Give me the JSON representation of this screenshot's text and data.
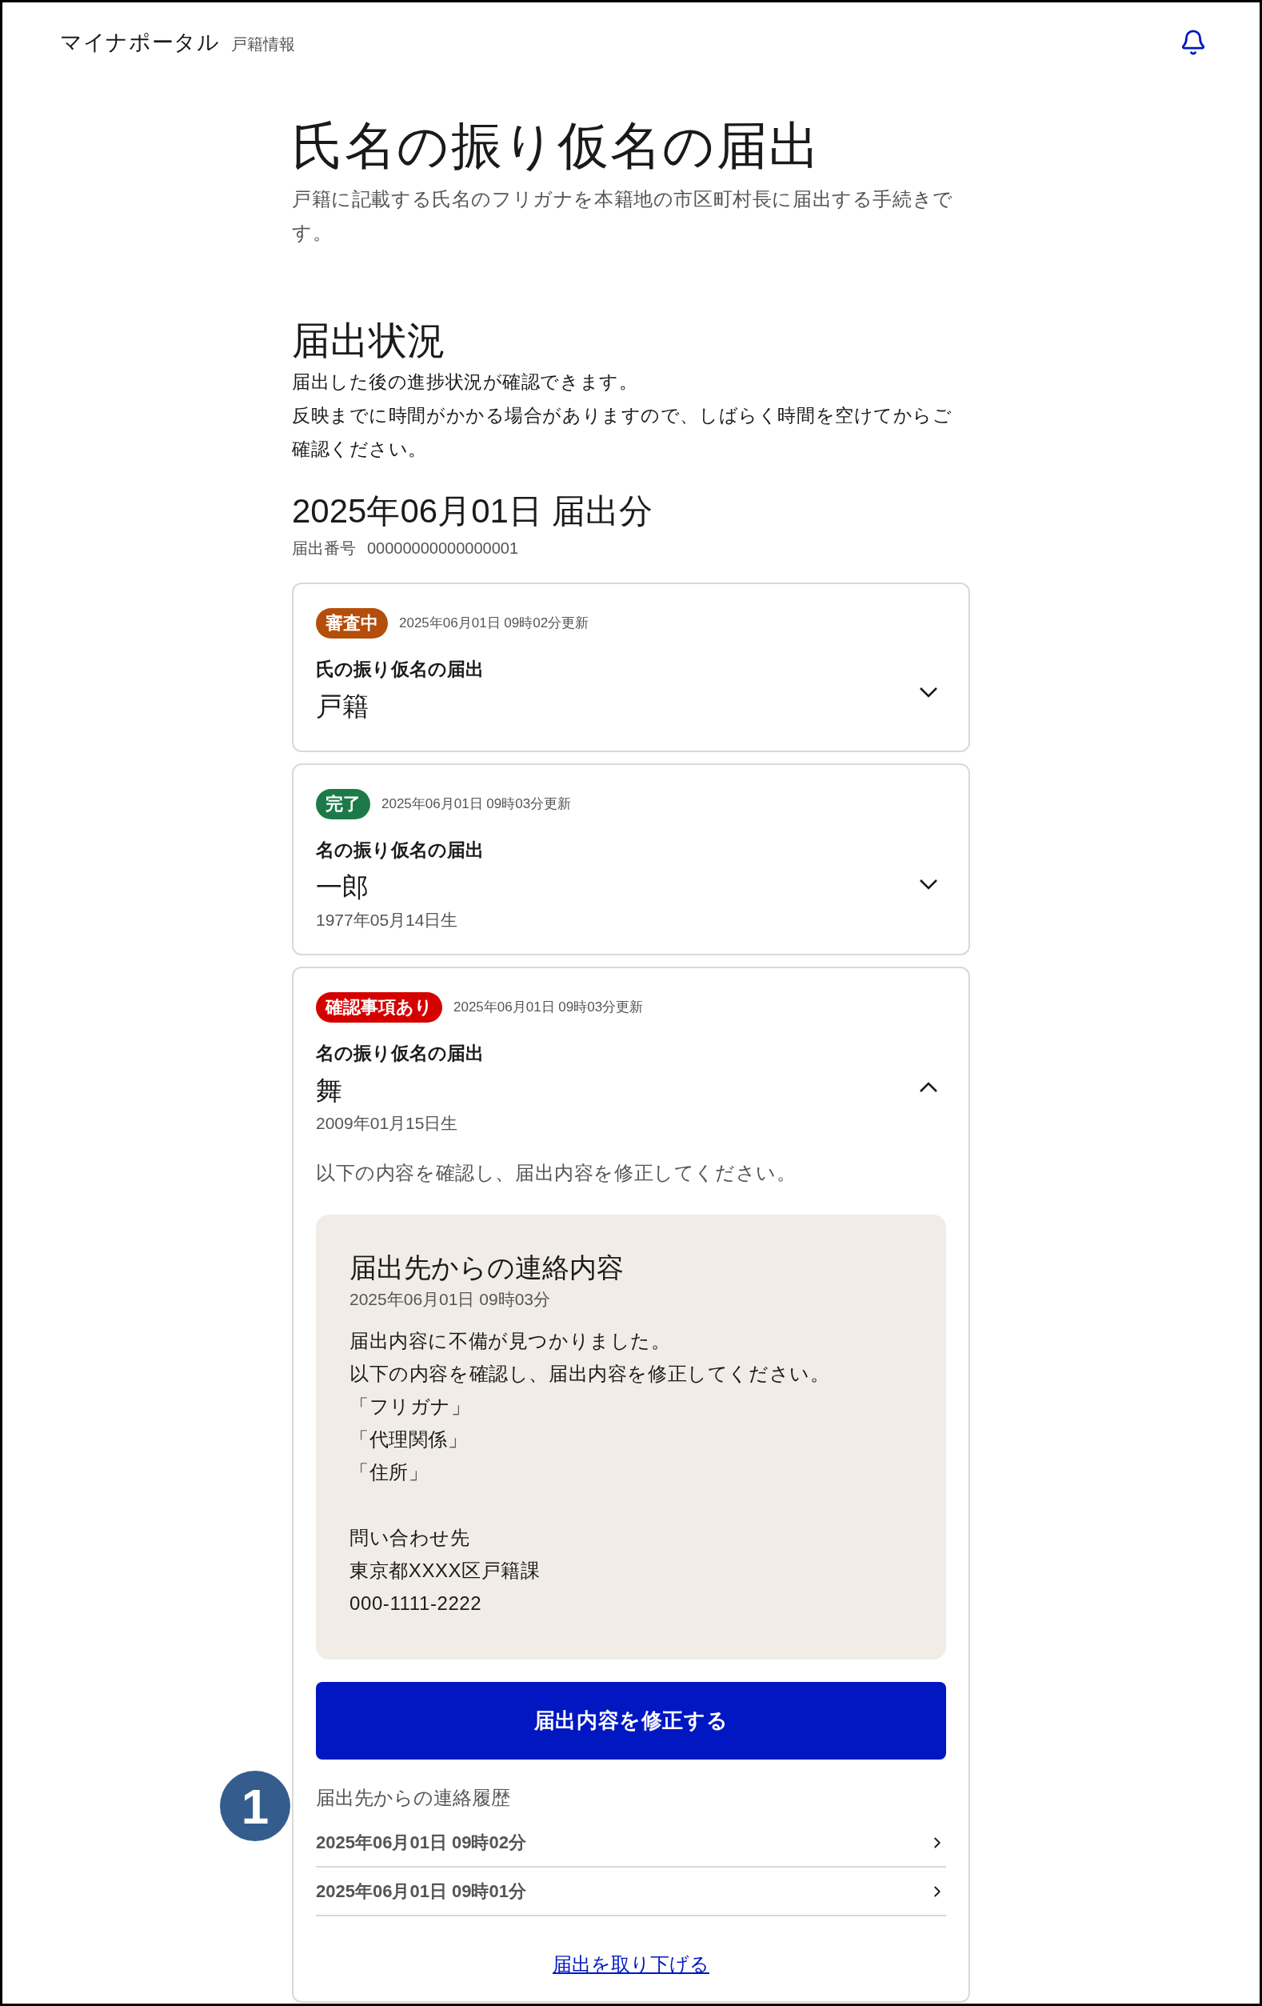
{
  "header": {
    "logo": "マイナポータル",
    "section": "戸籍情報"
  },
  "page": {
    "title": "氏名の振り仮名の届出",
    "description": "戸籍に記載する氏名のフリガナを本籍地の市区町村長に届出する手続きです。"
  },
  "status": {
    "heading": "届出状況",
    "paragraphs": [
      "届出した後の進捗状況が確認できます。",
      "反映までに時間がかかる場合がありますので、しばらく時間を空けてからご確認ください。"
    ]
  },
  "submission": {
    "date": "2025年06月01日 届出分",
    "number_label": "届出番号",
    "number": "00000000000000001"
  },
  "cards": [
    {
      "status": "審査中",
      "color": "#b54d0b",
      "updated": "2025年06月01日 09時02分更新",
      "type": "氏の振り仮名の届出",
      "name": "戸籍",
      "expanded": false
    },
    {
      "status": "完了",
      "color": "#1d7a48",
      "updated": "2025年06月01日 09時03分更新",
      "type": "名の振り仮名の届出",
      "name": "一郎",
      "birth": "1977年05月14日生",
      "expanded": false
    },
    {
      "status": "確認事項あり",
      "color": "#d50000",
      "updated": "2025年06月01日 09時03分更新",
      "type": "名の振り仮名の届出",
      "name": "舞",
      "birth": "2009年01月15日生",
      "expanded": true,
      "detail": {
        "instruction": "以下の内容を確認し、届出内容を修正してください。",
        "message": {
          "title": "届出先からの連絡内容",
          "date": "2025年06月01日 09時03分",
          "lines": [
            "届出内容に不備が見つかりました。",
            "以下の内容を確認し、届出内容を修正してください。",
            "「フリガナ」",
            "「代理関係」",
            "「住所」"
          ],
          "contact": [
            "問い合わせ先",
            "東京都XXXX区戸籍課",
            "000-1111-2222"
          ]
        },
        "button": "届出内容を修正する",
        "history": {
          "heading": "届出先からの連絡履歴",
          "marker": "1",
          "items": [
            "2025年06月01日 09時02分",
            "2025年06月01日 09時01分"
          ]
        },
        "withdraw": "届出を取り下げる"
      }
    }
  ]
}
